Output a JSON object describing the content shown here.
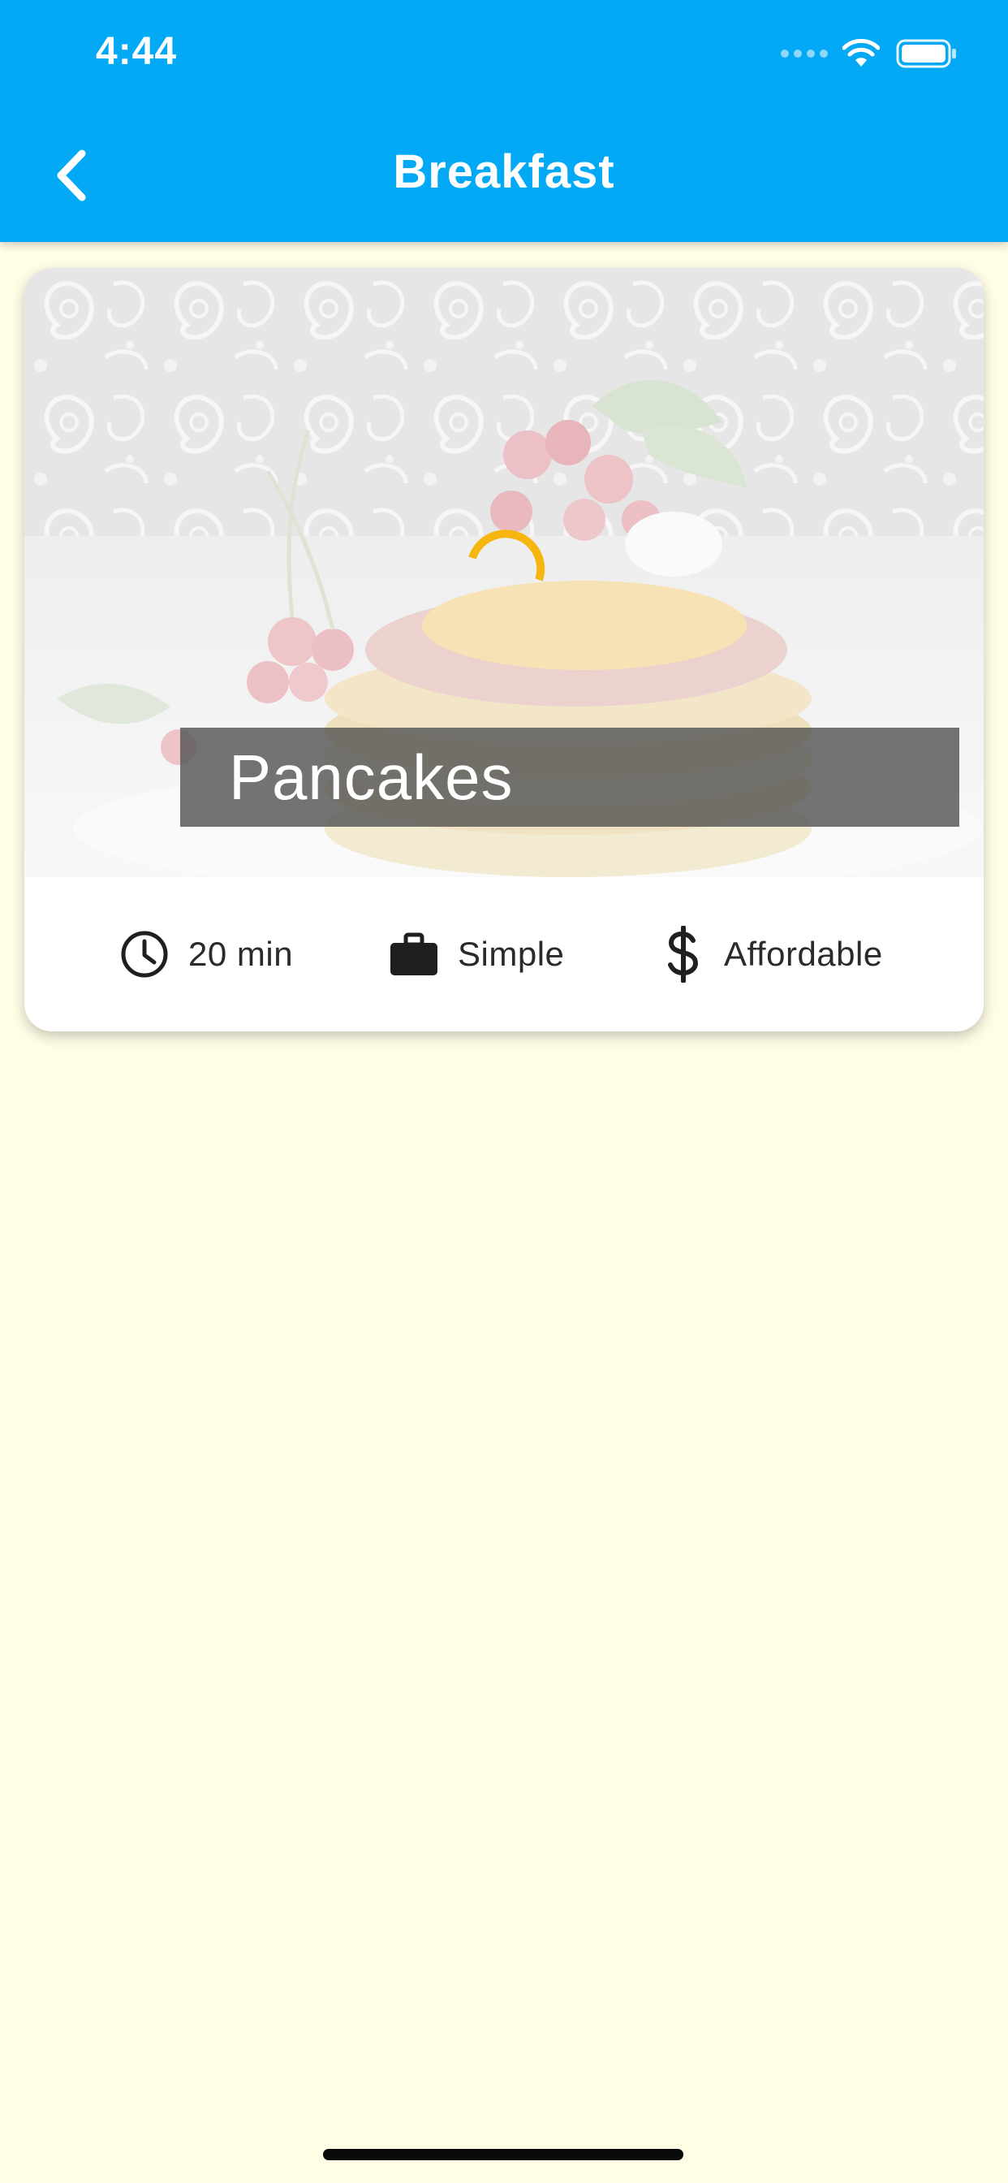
{
  "status_bar": {
    "time": "4:44"
  },
  "app_bar": {
    "title": "Breakfast",
    "back_icon": "chevron-left-icon",
    "background_color": "#03a9f4"
  },
  "meal_card": {
    "title": "Pancakes",
    "loading": true,
    "spinner_color": "#f6b60f",
    "info": {
      "duration": {
        "icon": "clock-icon",
        "label": "20 min"
      },
      "complexity": {
        "icon": "briefcase-icon",
        "label": "Simple"
      },
      "affordability": {
        "icon": "dollar-icon",
        "label": "Affordable"
      }
    }
  },
  "page": {
    "background_color": "#fffde6"
  }
}
